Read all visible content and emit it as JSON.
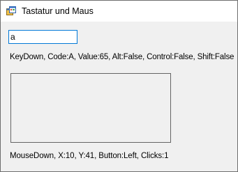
{
  "window": {
    "title": "Tastatur und Maus",
    "icon": "winforms-app-icon"
  },
  "form": {
    "textbox_value": "a",
    "key_event_text": "KeyDown, Code:A, Value:65, Alt:False, Control:False, Shift:False",
    "mouse_event_text": "MouseDown, X:10, Y:41, Button:Left, Clicks:1"
  },
  "colors": {
    "focus_border": "#0078d7",
    "window_background": "#f0f0f0",
    "panel_border": "#646464"
  }
}
